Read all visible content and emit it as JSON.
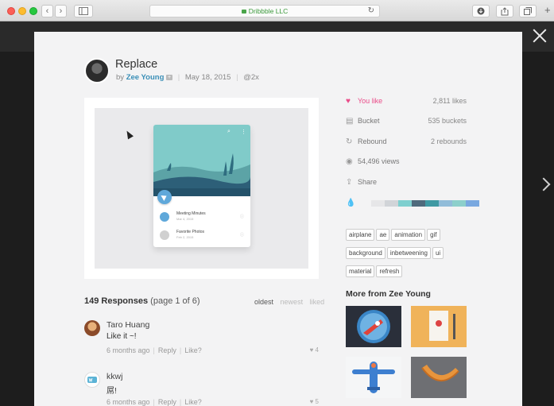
{
  "browser": {
    "url": "Dribbble LLC",
    "back": "‹",
    "forward": "›"
  },
  "shot": {
    "title": "Replace",
    "by": "by",
    "author": "Zee Young",
    "pro_badge": "+",
    "date": "May 18, 2015",
    "zoom": "@2x",
    "mock": {
      "rows": [
        {
          "title": "Meeting Minutes",
          "date": "Mar 4, 2015"
        },
        {
          "title": "Favorite Photos",
          "date": "Feb 2, 2015"
        }
      ]
    }
  },
  "stats": [
    {
      "icon": "♥",
      "label": "You like",
      "value": "2,811 likes"
    },
    {
      "icon": "▤",
      "label": "Bucket",
      "value": "535 buckets"
    },
    {
      "icon": "↻",
      "label": "Rebound",
      "value": "2 rebounds"
    },
    {
      "icon": "◉",
      "label": "54,496 views",
      "value": ""
    },
    {
      "icon": "⇪",
      "label": "Share",
      "value": ""
    }
  ],
  "palette": [
    "#e6e6e8",
    "#d1d4d8",
    "#7ecfcf",
    "#4f6a7c",
    "#3f99a3",
    "#91bcd9",
    "#8ccfcb",
    "#79a8e0"
  ],
  "tags": [
    "airplane",
    "ae",
    "animation",
    "gif",
    "background",
    "inbetweening",
    "ui",
    "material",
    "refresh"
  ],
  "more": {
    "title": "More from Zee Young"
  },
  "responses": {
    "count": "149 Responses",
    "page": "(page 1 of 6)",
    "sort": [
      "oldest",
      "newest",
      "liked"
    ],
    "items": [
      {
        "name": "Taro Huang",
        "text": "Like it ~!",
        "time": "6 months ago",
        "reply": "Reply",
        "like": "Like?",
        "likes": "4"
      },
      {
        "name": "kkwj",
        "text": "屌!",
        "time": "6 months ago",
        "reply": "Reply",
        "like": "Like?",
        "likes": "5"
      }
    ]
  }
}
